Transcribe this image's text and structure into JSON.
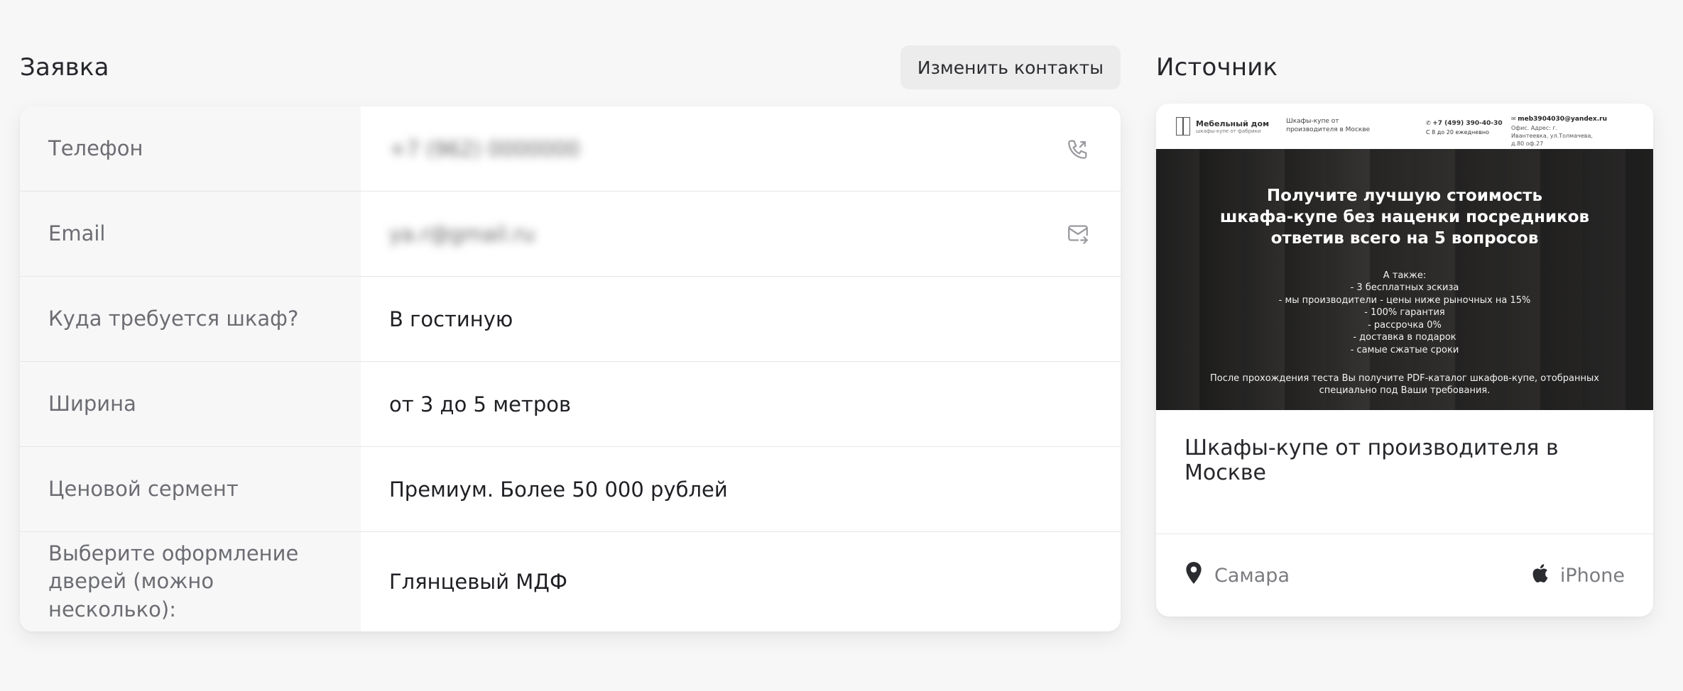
{
  "request": {
    "title": "Заявка",
    "change_contacts_label": "Изменить контакты",
    "rows": [
      {
        "label": "Телефон",
        "value": "+7 (962) 0000000",
        "blurred": true,
        "icon": "phone-outgoing-icon"
      },
      {
        "label": "Email",
        "value": "ya.r@gmail.ru",
        "blurred": true,
        "icon": "mail-forward-icon"
      },
      {
        "label": "Куда требуется шкаф?",
        "value": "В гостиную"
      },
      {
        "label": "Ширина",
        "value": "от 3 до 5 метров"
      },
      {
        "label": "Ценовой сермент",
        "value": "Премиум. Более 50 000 рублей"
      },
      {
        "label": "Выберите оформление дверей (можно несколько):",
        "value": "Глянцевый МДФ"
      }
    ]
  },
  "source": {
    "title": "Источник",
    "preview": {
      "brand_name": "Мебельный дом",
      "brand_sub": "шкафы-купе от фабрики",
      "tagline": "Шкафы-купе от производителя в Москве",
      "phone": "+7 (499) 390-40-30",
      "phone_hours": "С 8 до 20 ежедневно",
      "email": "meb3904030@yandex.ru",
      "address": "Офис. Адрес: г. Ивантеевка, ул.Толмачева, д.80 оф.27",
      "hero_title": "Получите лучшую стоимость\nшкафа-купе без наценки посредников\nответив всего на 5 вопросов",
      "hero_list": [
        "А также:",
        "- 3 бесплатных эскиза",
        "- мы производители - цены ниже рыночных на 15%",
        "- 100% гарантия",
        "- рассрочка 0%",
        "- доставка в подарок",
        "- самые сжатые сроки"
      ],
      "hero_note": "После прохождения теста Вы получите PDF-каталог шкафов-купе, отобранных специально под Ваши требования."
    },
    "site_title": "Шкафы-купе от производителя в Москве",
    "city": "Самара",
    "device": "iPhone"
  },
  "colors": {
    "background": "#f7f7f8",
    "label_bg": "#f7f7f8",
    "button_bg": "#ececed"
  }
}
